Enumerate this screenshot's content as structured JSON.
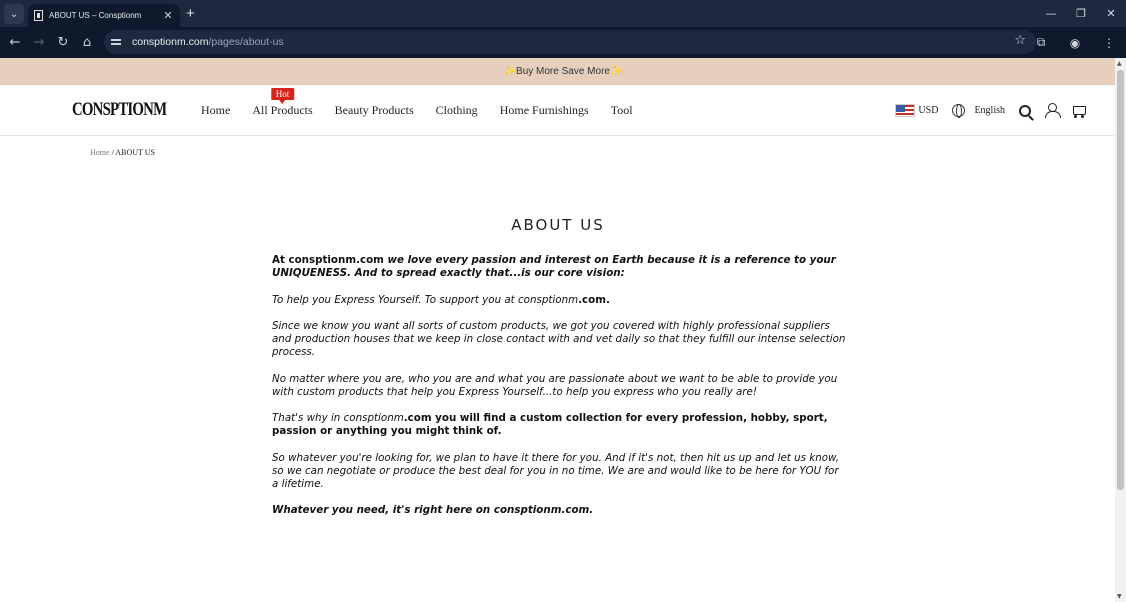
{
  "browser": {
    "tab_title": "ABOUT US – Consptionm",
    "tab_close": "✕",
    "new_tab": "+",
    "url_domain": "consptionm.com",
    "url_path": "/pages/about-us"
  },
  "promo": {
    "text": "✨Buy More Save More✨"
  },
  "header": {
    "logo": "CONSPTIONM",
    "menu": [
      {
        "label": "Home"
      },
      {
        "label": "All Products",
        "badge": "Hot"
      },
      {
        "label": "Beauty Products"
      },
      {
        "label": "Clothing"
      },
      {
        "label": "Home Furnishings"
      },
      {
        "label": "Tool"
      }
    ],
    "currency": "USD",
    "language": "English"
  },
  "breadcrumb": {
    "home": "Home",
    "separator": "/",
    "current": "ABOUT US"
  },
  "page": {
    "title": "ABOUT US",
    "p1_a": "At consptionm",
    "p1_b": ".com",
    "p1_c": " we love every passion and interest on Earth because it is a reference to your UNIQUENESS. And to spread exactly that...is our core vision:",
    "p2_a": "To help you Express Yourself. To support you at consptionm",
    "p2_b": ".com.",
    "p3": "Since we know you want all sorts of custom products, we got you covered with highly professional suppliers and production houses that we keep in close contact with and vet daily so that they fulfill our intense selection process.",
    "p4": "No matter where you are, who you are and what you are passionate about we want to be able to provide you with custom products that help you Express Yourself...to help you express who you really are!",
    "p5_a": "That's why in consptionm",
    "p5_b": ".com you will find a custom collection for every profession, hobby, sport, passion or anything you might think of.",
    "p6": "So whatever you're looking for, we plan to have it there for you. And if it's not, then hit us up and let us know, so we can negotiate or produce the best deal for you in no time. We are and would like to be here for YOU for a lifetime.",
    "p7": "Whatever you need, it's right here on consptionm.com."
  }
}
